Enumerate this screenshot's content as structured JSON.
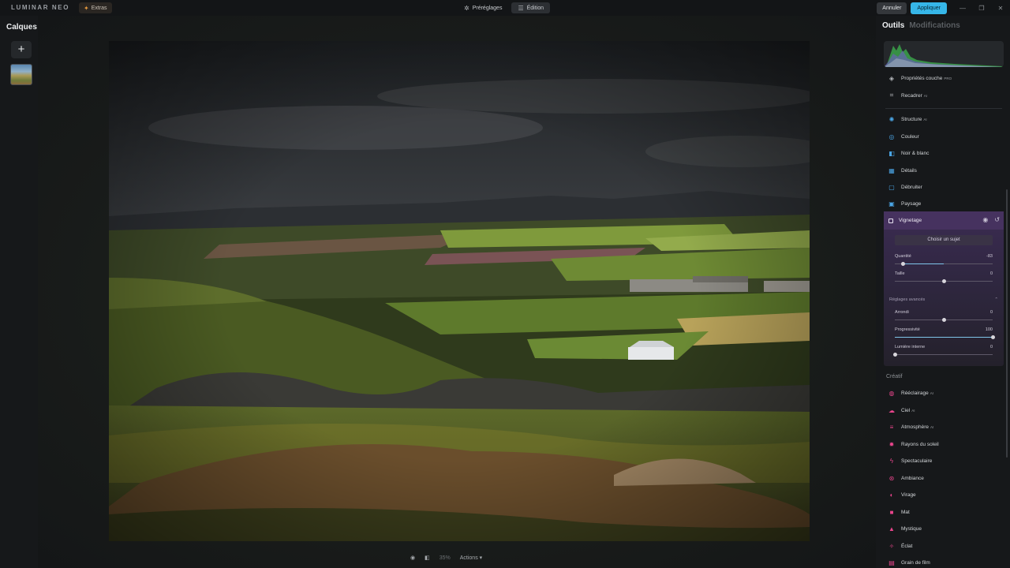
{
  "topbar": {
    "logo": "LUMINAR NEO",
    "extras_label": "Extras",
    "tabs": [
      {
        "label": "Préréglages",
        "icon": "presets-icon"
      },
      {
        "label": "Édition",
        "icon": "edit-icon"
      }
    ],
    "cancel_label": "Annuler",
    "apply_label": "Appliquer"
  },
  "layers": {
    "title": "Calques",
    "add_symbol": "+"
  },
  "bottom": {
    "zoom": "35%",
    "actions_label": "Actions"
  },
  "panel": {
    "tab_tools": "Outils",
    "tab_edits": "Modifications",
    "tools_top": [
      {
        "label": "Propriétés couche",
        "icon": "layers-icon",
        "icon_color": "#b9bcc0",
        "ai": "PRO"
      },
      {
        "label": "Recadrer",
        "icon": "crop-icon",
        "icon_color": "#b9bcc0",
        "ai": "AI"
      }
    ],
    "tools_essentials": [
      {
        "label": "Structure",
        "icon": "structure-icon",
        "icon_color": "#4ba6e6",
        "ai": "AI"
      },
      {
        "label": "Couleur",
        "icon": "color-icon",
        "icon_color": "#4ba6e6",
        "ai": ""
      },
      {
        "label": "Noir & blanc",
        "icon": "bw-icon",
        "icon_color": "#4ba6e6",
        "ai": ""
      },
      {
        "label": "Détails",
        "icon": "details-icon",
        "icon_color": "#4ba6e6",
        "ai": ""
      },
      {
        "label": "Débruiter",
        "icon": "denoise-icon",
        "icon_color": "#4ba6e6",
        "ai": ""
      },
      {
        "label": "Paysage",
        "icon": "landscape-icon",
        "icon_color": "#4ba6e6",
        "ai": ""
      }
    ],
    "vignette": {
      "title": "Vignetage",
      "choose_subject": "Choisir un sujet",
      "sliders": [
        {
          "label": "Quantité",
          "value": "-83",
          "fraction": -0.83
        },
        {
          "label": "Taille",
          "value": "0",
          "fraction": 0
        }
      ],
      "advanced_label": "Réglages avancés",
      "advanced_sliders": [
        {
          "label": "Arrondi",
          "value": "0",
          "fraction": 0
        },
        {
          "label": "Progressivité",
          "value": "100",
          "fraction": 1
        },
        {
          "label": "Lumière interne",
          "value": "0",
          "fraction": 0
        }
      ]
    },
    "creative_label": "Créatif",
    "tools_creative": [
      {
        "label": "Rééclairage",
        "icon": "relight-icon",
        "icon_color": "#e8458c",
        "ai": "AI"
      },
      {
        "label": "Ciel",
        "icon": "sky-icon",
        "icon_color": "#e8458c",
        "ai": "AI"
      },
      {
        "label": "Atmosphère",
        "icon": "atmosphere-icon",
        "icon_color": "#e8458c",
        "ai": "AI"
      },
      {
        "label": "Rayons du soleil",
        "icon": "sunrays-icon",
        "icon_color": "#e8458c",
        "ai": ""
      },
      {
        "label": "Spectaculaire",
        "icon": "dramatic-icon",
        "icon_color": "#e8458c",
        "ai": ""
      },
      {
        "label": "Ambiance",
        "icon": "mood-icon",
        "icon_color": "#e8458c",
        "ai": ""
      },
      {
        "label": "Virage",
        "icon": "toning-icon",
        "icon_color": "#e8458c",
        "ai": ""
      },
      {
        "label": "Mat",
        "icon": "matte-icon",
        "icon_color": "#e8458c",
        "ai": ""
      },
      {
        "label": "Mystique",
        "icon": "mystical-icon",
        "icon_color": "#e8458c",
        "ai": ""
      },
      {
        "label": "Éclat",
        "icon": "glow-icon",
        "icon_color": "#e8458c",
        "ai": ""
      },
      {
        "label": "Grain de film",
        "icon": "film-grain-icon",
        "icon_color": "#e8458c",
        "ai": ""
      }
    ]
  }
}
